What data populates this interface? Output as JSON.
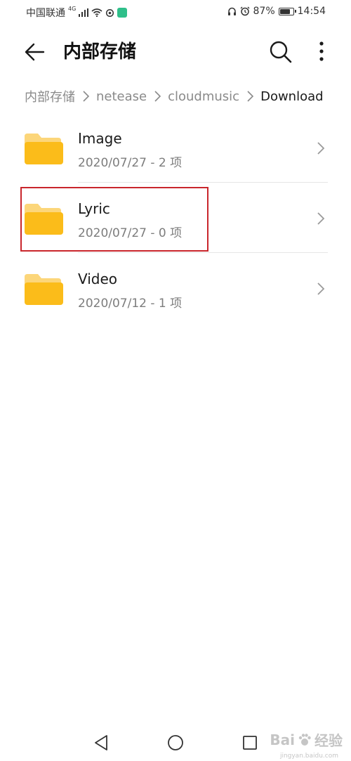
{
  "status_bar": {
    "carrier": "中国联通",
    "network": "4G",
    "battery": "87%",
    "battery_level": 0.87,
    "time": "14:54"
  },
  "app_bar": {
    "title": "内部存储",
    "back_icon": "arrow-left-icon",
    "search_icon": "search-icon",
    "more_icon": "more-vertical-icon"
  },
  "breadcrumb": {
    "items": [
      "内部存储",
      "netease",
      "cloudmusic",
      "Download"
    ]
  },
  "files": [
    {
      "name": "Image",
      "meta": "2020/07/27 - 2 项"
    },
    {
      "name": "Lyric",
      "meta": "2020/07/27 - 0 项"
    },
    {
      "name": "Video",
      "meta": "2020/07/12 - 1 项"
    }
  ],
  "colors": {
    "folder_main": "#FBBC1A",
    "folder_tab": "#FCD67A",
    "highlight": "#C9262C"
  },
  "watermark": {
    "brand": "Bai",
    "brand_suffix": "经验",
    "url": "jingyan.baidu.com"
  }
}
